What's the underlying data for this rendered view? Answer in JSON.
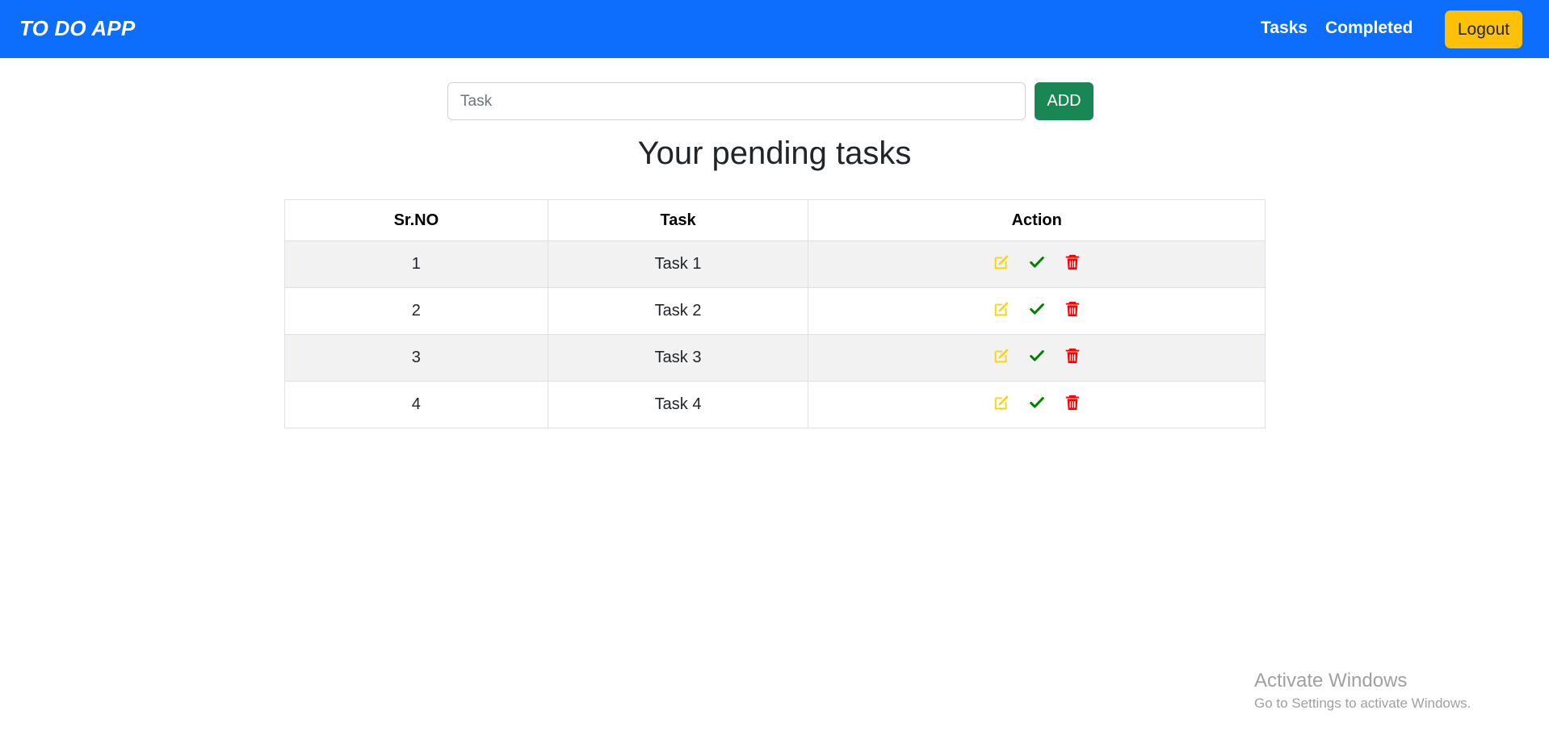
{
  "navbar": {
    "brand": "TO DO APP",
    "links": {
      "tasks": "Tasks",
      "completed": "Completed"
    },
    "logout_label": "Logout"
  },
  "form": {
    "task_input": {
      "placeholder": "Task",
      "value": ""
    },
    "add_label": "ADD"
  },
  "main": {
    "title": "Your pending tasks",
    "table": {
      "headers": {
        "sr": "Sr.NO",
        "task": "Task",
        "action": "Action"
      },
      "rows": [
        {
          "sr": "1",
          "task": "Task 1"
        },
        {
          "sr": "2",
          "task": "Task 2"
        },
        {
          "sr": "3",
          "task": "Task 3"
        },
        {
          "sr": "4",
          "task": "Task 4"
        }
      ]
    }
  },
  "icons": {
    "edit": "edit-icon",
    "complete": "check-icon",
    "delete": "trash-icon"
  },
  "colors": {
    "navbar": "#0d6efd",
    "logout": "#ffc107",
    "add": "#198754",
    "edit_icon": "#ffd400",
    "check_icon": "#008000",
    "trash_icon": "#ff0000"
  },
  "watermark": {
    "title": "Activate Windows",
    "subtitle": "Go to Settings to activate Windows."
  }
}
